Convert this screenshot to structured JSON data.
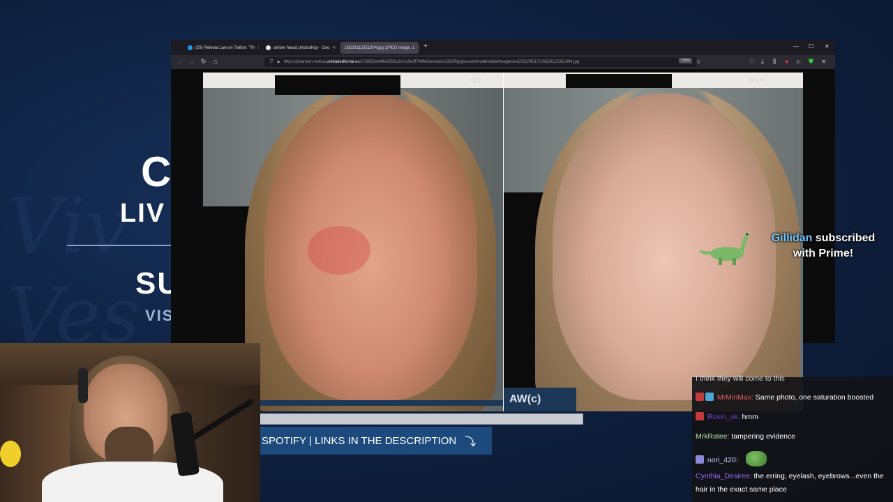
{
  "browser": {
    "tabs": [
      {
        "label": "(29) Rekieta Law on Twitter: \"Th",
        "active": false,
        "icon": "twitter-icon"
      },
      {
        "label": "amber heard photoshop - Goo",
        "active": false,
        "icon": "google-icon"
      },
      {
        "label": "16528115351804.jpg (JPEG Image, 1",
        "active": true,
        "icon": "image-icon"
      }
    ],
    "url_prefix": "https://phantom-marca.",
    "url_domain": "unidadeditorial.es",
    "url_path": "/17d825ed48e0556c2cf1c0e3f748fe5e/resize/1320/f/jpg/assets/multimedia/imagenes/2022/05/17/16528115351804.jpg",
    "zoom": "130%"
  },
  "background": {
    "c": "C",
    "liv": "LIV",
    "su": "SU",
    "vis": "VIS"
  },
  "photo": {
    "right_panel_text": "AW(c) "
  },
  "banner": {
    "text": "SPOTIFY | LINKS IN THE DESCRIPTION"
  },
  "alert": {
    "name": "Gillidan",
    "rest": "subscribed",
    "line2": "with Prime!"
  },
  "chat": [
    {
      "user": "",
      "user_color": "#e05a5a",
      "message": "I think they will come to this",
      "badges": []
    },
    {
      "user": "MrMinMax:",
      "user_color": "#e05a5a",
      "message": "Same photo, one saturation boosted",
      "badges": [
        "#c43b3b",
        "#4aa8d8"
      ]
    },
    {
      "user": "Rosin_ok:",
      "user_color": "#7a3fd0",
      "message": "hmm",
      "badges": [
        "#c43b3b"
      ]
    },
    {
      "user": "MrkRatee:",
      "user_color": "#b8e0a8",
      "message": "tampering evidence",
      "badges": []
    },
    {
      "user": "nori_420:",
      "user_color": "#d9c8ff",
      "message": "",
      "badges": [
        "#8a8ad8"
      ],
      "emote": true
    },
    {
      "user": "Cynthia_Desiree:",
      "user_color": "#9a6bff",
      "message": "the erring, eyelash, eyebrows...even the hair in the exact same place",
      "badges": []
    }
  ],
  "colors": {
    "accent": "#1d4a7c",
    "background": "#0f1f3a"
  }
}
